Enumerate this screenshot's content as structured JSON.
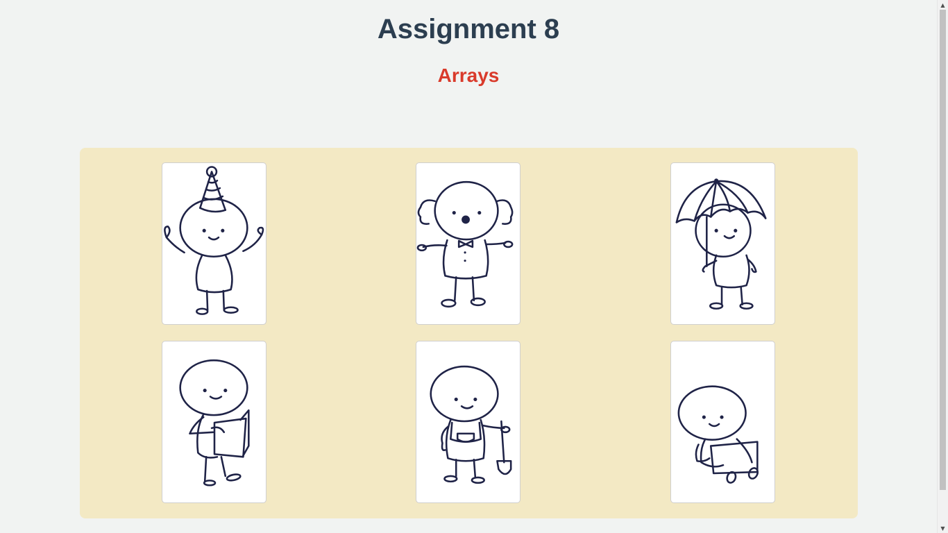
{
  "page": {
    "title": "Assignment 8",
    "subtitle": "Arrays"
  },
  "colors": {
    "title": "#2c3e50",
    "subtitle": "#d93a2b",
    "panel_background": "#f3e9c4",
    "page_background": "#f1f3f2",
    "ink": "#1f2347"
  },
  "gallery": {
    "items": [
      {
        "icon": "party-hat-doodle-icon"
      },
      {
        "icon": "clown-doodle-icon"
      },
      {
        "icon": "umbrella-doodle-icon"
      },
      {
        "icon": "reading-book-doodle-icon"
      },
      {
        "icon": "gardener-shovel-doodle-icon"
      },
      {
        "icon": "laptop-sitting-doodle-icon"
      }
    ]
  }
}
